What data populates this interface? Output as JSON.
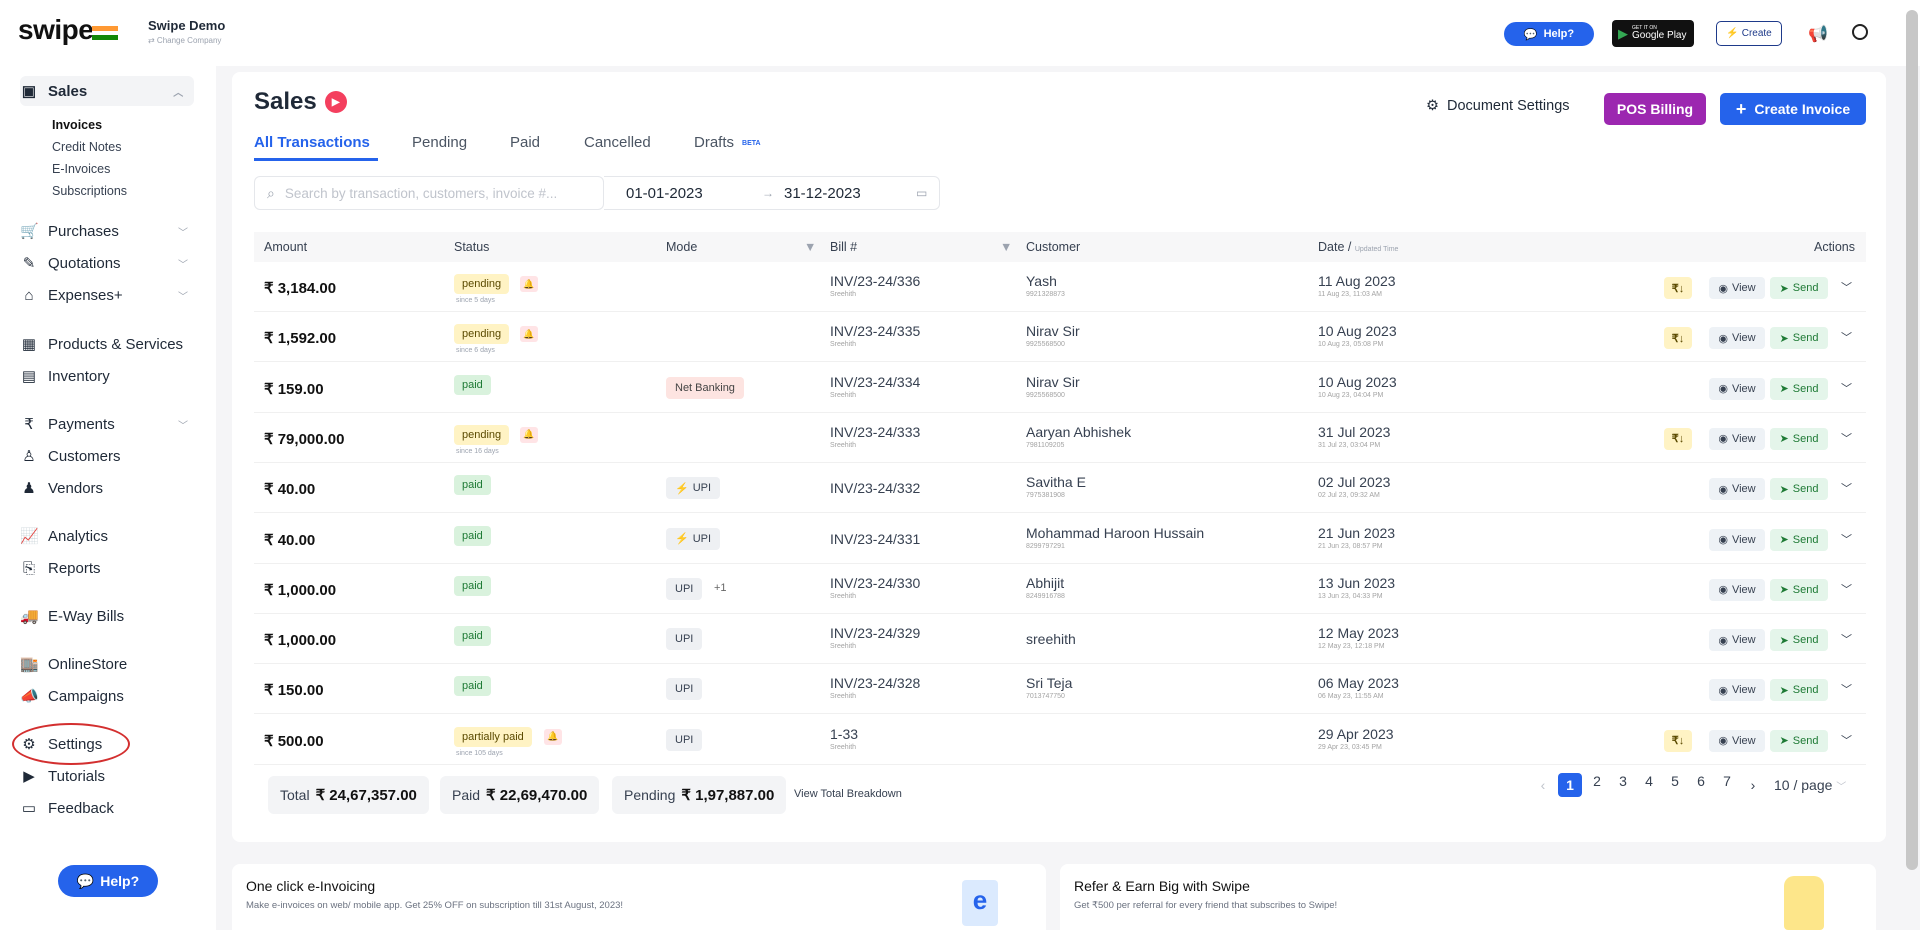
{
  "header": {
    "logo": "swipe",
    "company_name": "Swipe Demo",
    "change_company": "⇄ Change Company",
    "help_label": "Help?",
    "gplay_small": "GET IT ON",
    "gplay_label": "Google Play",
    "create_label": "Create"
  },
  "sidebar": {
    "sales": "Sales",
    "sales_sub": [
      "Invoices",
      "Credit Notes",
      "E-Invoices",
      "Subscriptions"
    ],
    "purchases": "Purchases",
    "quotations": "Quotations",
    "expenses": "Expenses+",
    "products": "Products & Services",
    "inventory": "Inventory",
    "payments": "Payments",
    "customers": "Customers",
    "vendors": "Vendors",
    "analytics": "Analytics",
    "reports": "Reports",
    "eway": "E-Way Bills",
    "onlinestore": "OnlineStore",
    "campaigns": "Campaigns",
    "settings": "Settings",
    "tutorials": "Tutorials",
    "feedback": "Feedback",
    "help": "Help?"
  },
  "page": {
    "title": "Sales",
    "tabs": [
      "All Transactions",
      "Pending",
      "Paid",
      "Cancelled",
      "Drafts"
    ],
    "beta": "BETA",
    "doc_settings": "Document Settings",
    "pos_billing": "POS Billing",
    "create_invoice": "Create Invoice",
    "search_placeholder": "Search by transaction, customers, invoice #...",
    "date_from": "01-01-2023",
    "date_to": "31-12-2023",
    "date_arrow": "→"
  },
  "table": {
    "headers": {
      "amount": "Amount",
      "status": "Status",
      "mode": "Mode",
      "bill": "Bill #",
      "customer": "Customer",
      "date": "Date /",
      "date_sub": "Updated Time",
      "actions": "Actions"
    },
    "view_label": "View",
    "send_label": "Send",
    "rs_label": "₹↓",
    "rows": [
      {
        "amount": "₹ 3,184.00",
        "status": "pending",
        "status_sub": "since 5 days",
        "mode": "",
        "bill": "INV/23-24/336",
        "bill_sub": "Sreehith",
        "customer": "Yash",
        "customer_sub": "9921328873",
        "date": "11 Aug 2023",
        "date_sub": "11 Aug 23, 11:03 AM"
      },
      {
        "amount": "₹ 1,592.00",
        "status": "pending",
        "status_sub": "since 6 days",
        "mode": "",
        "bill": "INV/23-24/335",
        "bill_sub": "Sreehith",
        "customer": "Nirav Sir",
        "customer_sub": "9925568500",
        "date": "10 Aug 2023",
        "date_sub": "10 Aug 23, 05:08 PM"
      },
      {
        "amount": "₹ 159.00",
        "status": "paid",
        "status_sub": "",
        "mode": "Net Banking",
        "bill": "INV/23-24/334",
        "bill_sub": "Sreehith",
        "customer": "Nirav Sir",
        "customer_sub": "9925568500",
        "date": "10 Aug 2023",
        "date_sub": "10 Aug 23, 04:04 PM"
      },
      {
        "amount": "₹ 79,000.00",
        "status": "pending",
        "status_sub": "since 16 days",
        "mode": "",
        "bill": "INV/23-24/333",
        "bill_sub": "Sreehith",
        "customer": "Aaryan Abhishek",
        "customer_sub": "7981109205",
        "date": "31 Jul 2023",
        "date_sub": "31 Jul 23, 03:04 PM"
      },
      {
        "amount": "₹ 40.00",
        "status": "paid",
        "status_sub": "",
        "mode": "UPI",
        "bill": "INV/23-24/332",
        "bill_sub": "",
        "customer": "Savitha E",
        "customer_sub": "7975381908",
        "date": "02 Jul 2023",
        "date_sub": "02 Jul 23, 09:32 AM"
      },
      {
        "amount": "₹ 40.00",
        "status": "paid",
        "status_sub": "",
        "mode": "UPI",
        "bill": "INV/23-24/331",
        "bill_sub": "",
        "customer": "Mohammad Haroon Hussain",
        "customer_sub": "8299797291",
        "date": "21 Jun 2023",
        "date_sub": "21 Jun 23, 08:57 PM"
      },
      {
        "amount": "₹ 1,000.00",
        "status": "paid",
        "status_sub": "",
        "mode": "UPI",
        "mode_extra": "+1",
        "bill": "INV/23-24/330",
        "bill_sub": "Sreehith",
        "customer": "Abhijit",
        "customer_sub": "8249916788",
        "date": "13 Jun 2023",
        "date_sub": "13 Jun 23, 04:33 PM"
      },
      {
        "amount": "₹ 1,000.00",
        "status": "paid",
        "status_sub": "",
        "mode": "UPI",
        "bill": "INV/23-24/329",
        "bill_sub": "Sreehith",
        "customer": "sreehith",
        "customer_sub": "",
        "date": "12 May 2023",
        "date_sub": "12 May 23, 12:18 PM"
      },
      {
        "amount": "₹ 150.00",
        "status": "paid",
        "status_sub": "",
        "mode": "UPI",
        "bill": "INV/23-24/328",
        "bill_sub": "Sreehith",
        "customer": "Sri Teja",
        "customer_sub": "7013747750",
        "date": "06 May 2023",
        "date_sub": "06 May 23, 11:55 AM"
      },
      {
        "amount": "₹ 500.00",
        "status": "partially paid",
        "status_sub": "since 105 days",
        "mode": "UPI",
        "bill": "1-33",
        "bill_sub": "Sreehith",
        "customer": "",
        "customer_sub": "",
        "date": "29 Apr 2023",
        "date_sub": "29 Apr 23, 03:45 PM"
      }
    ]
  },
  "totals": {
    "total_label": "Total",
    "total": "₹ 24,67,357.00",
    "paid_label": "Paid",
    "paid": "₹ 22,69,470.00",
    "pending_label": "Pending",
    "pending": "₹ 1,97,887.00",
    "breakdown": "View Total Breakdown"
  },
  "pagination": {
    "pages": [
      "1",
      "2",
      "3",
      "4",
      "5",
      "6",
      "7"
    ],
    "current": "1",
    "per_page": "10 / page"
  },
  "promos": [
    {
      "title": "One click e-Invoicing",
      "text": "Make e-invoices on web/ mobile app. Get 25% OFF on subscription till 31st August, 2023!"
    },
    {
      "title": "Refer & Earn Big with Swipe",
      "text": "Get ₹500 per referral for every friend that subscribes to Swipe!"
    }
  ],
  "colors": {
    "accent": "#2563eb",
    "pos": "#9c27b0",
    "pending_bg": "#fff3c4",
    "paid_bg": "#d9f2dd",
    "highlight_circle": "#d32f2f"
  }
}
